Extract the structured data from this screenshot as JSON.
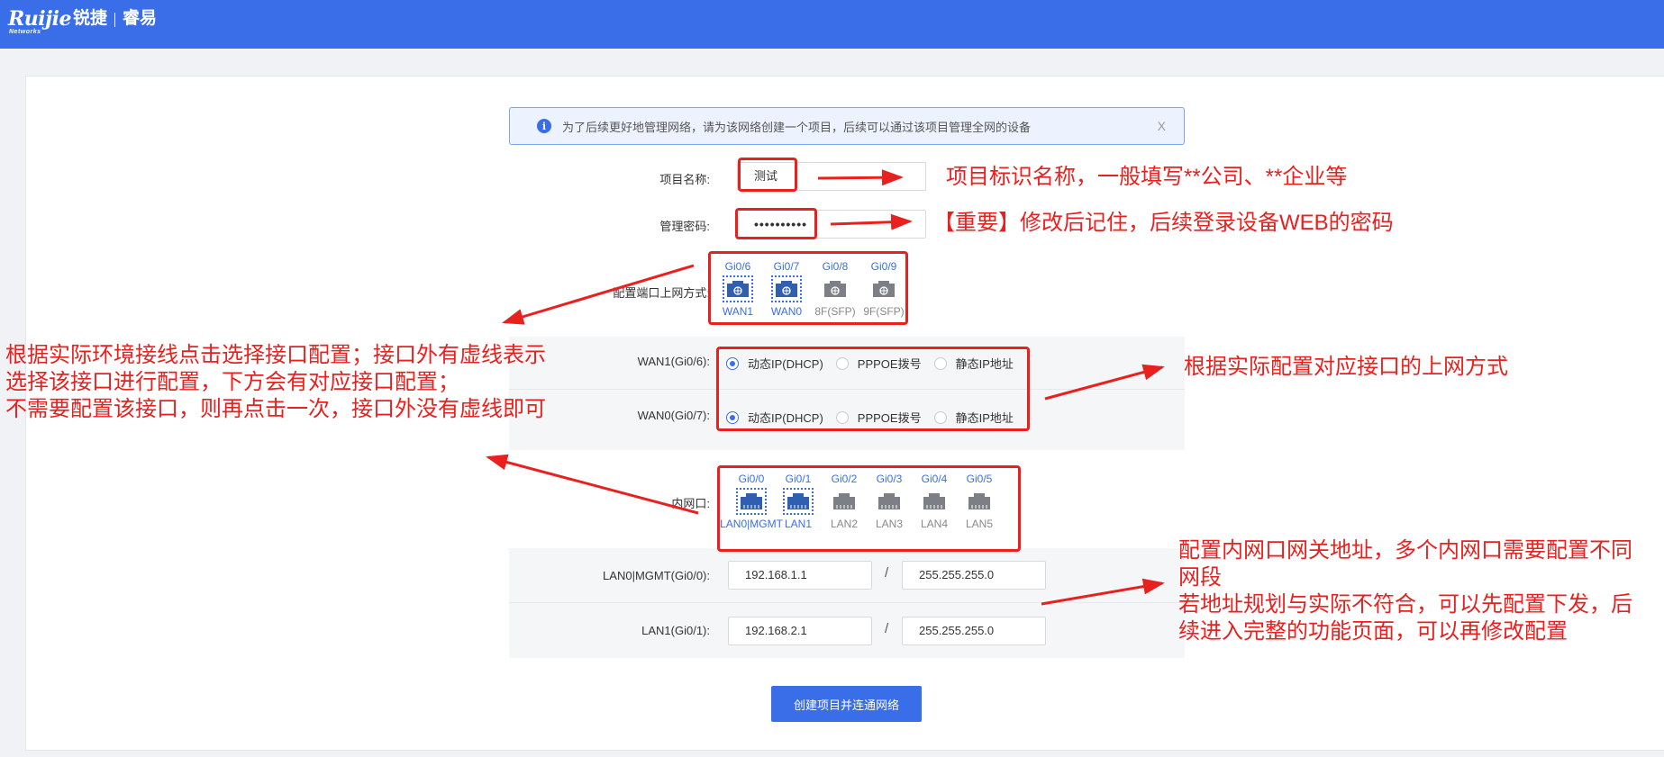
{
  "brand": {
    "logo_text": "Ruijie",
    "logo_cn": "锐捷",
    "logo_sub": "Networks",
    "product": "睿易",
    "primary_color": "#3a6ee8",
    "annotation_color": "#e8211f"
  },
  "notice": {
    "icon": "info-icon",
    "text": "为了后续更好地管理网络，请为该网络创建一个项目，后续可以通过该项目管理全网的设备",
    "close": "X"
  },
  "form": {
    "project_name": {
      "label": "项目名称:",
      "value": "测试"
    },
    "password": {
      "label": "管理密码:",
      "value": "••••••••••"
    },
    "uplink": {
      "label": "配置端口上网方式:",
      "ports": [
        {
          "name": "Gi0/6",
          "label": "WAN1",
          "selected": true
        },
        {
          "name": "Gi0/7",
          "label": "WAN0",
          "selected": true
        },
        {
          "name": "Gi0/8",
          "label": "8F(SFP)",
          "selected": false
        },
        {
          "name": "Gi0/9",
          "label": "9F(SFP)",
          "selected": false
        }
      ]
    },
    "wan_rows": [
      {
        "label": "WAN1(Gi0/6):",
        "options": [
          "动态IP(DHCP)",
          "PPPOE拨号",
          "静态IP地址"
        ],
        "selected": "动态IP(DHCP)"
      },
      {
        "label": "WAN0(Gi0/7):",
        "options": [
          "动态IP(DHCP)",
          "PPPOE拨号",
          "静态IP地址"
        ],
        "selected": "动态IP(DHCP)"
      }
    ],
    "lan": {
      "label": "内网口:",
      "ports": [
        {
          "name": "Gi0/0",
          "label": "LAN0|MGMT",
          "selected": true
        },
        {
          "name": "Gi0/1",
          "label": "LAN1",
          "selected": true
        },
        {
          "name": "Gi0/2",
          "label": "LAN2",
          "selected": false
        },
        {
          "name": "Gi0/3",
          "label": "LAN3",
          "selected": false
        },
        {
          "name": "Gi0/4",
          "label": "LAN4",
          "selected": false
        },
        {
          "name": "Gi0/5",
          "label": "LAN5",
          "selected": false
        }
      ]
    },
    "lan_rows": [
      {
        "label": "LAN0|MGMT(Gi0/0):",
        "ip": "192.168.1.1",
        "mask": "255.255.255.0"
      },
      {
        "label": "LAN1(Gi0/1):",
        "ip": "192.168.2.1",
        "mask": "255.255.255.0"
      }
    ],
    "separator": "/",
    "submit_label": "创建项目并连通网络"
  },
  "annotations": {
    "project_name": "项目标识名称，一般填写**公司、**企业等",
    "password": "【重要】修改后记住，后续登录设备WEB的密码",
    "ports_left": [
      "根据实际环境接线点击选择接口配置；接口外有虚线表示",
      "选择该接口进行配置，下方会有对应接口配置；",
      "不需要配置该接口，则再点击一次，接口外没有虚线即可"
    ],
    "wan": "根据实际配置对应接口的上网方式",
    "lan": [
      "配置内网口网关地址，多个内网口需要配置不同",
      "网段",
      "若地址规划与实际不符合，可以先配置下发，后",
      "续进入完整的功能页面，可以再修改配置"
    ]
  }
}
